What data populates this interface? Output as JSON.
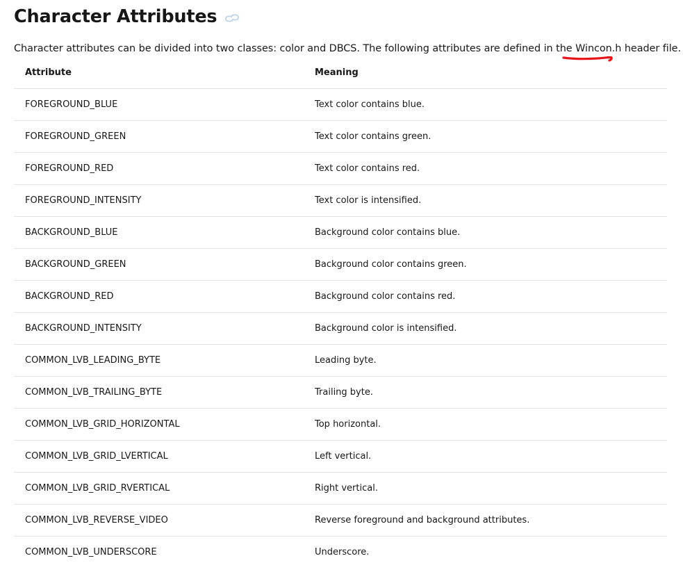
{
  "page": {
    "title": "Character Attributes",
    "intro_before": "Character attributes can be divided into two classes: color and DBCS. The following attributes are defined in the ",
    "intro_link": "Wincon.h",
    "intro_after": " header file."
  },
  "icons": {
    "permalink": "link-icon",
    "annotation": "red-underline-mark"
  },
  "colors": {
    "annotation_red": "#e8161b",
    "link_icon": "#b9d3ea",
    "row_border": "#e3e3e3"
  },
  "table": {
    "headers": [
      "Attribute",
      "Meaning"
    ],
    "rows": [
      [
        "FOREGROUND_BLUE",
        "Text color contains blue."
      ],
      [
        "FOREGROUND_GREEN",
        "Text color contains green."
      ],
      [
        "FOREGROUND_RED",
        "Text color contains red."
      ],
      [
        "FOREGROUND_INTENSITY",
        "Text color is intensified."
      ],
      [
        "BACKGROUND_BLUE",
        "Background color contains blue."
      ],
      [
        "BACKGROUND_GREEN",
        "Background color contains green."
      ],
      [
        "BACKGROUND_RED",
        "Background color contains red."
      ],
      [
        "BACKGROUND_INTENSITY",
        "Background color is intensified."
      ],
      [
        "COMMON_LVB_LEADING_BYTE",
        "Leading byte."
      ],
      [
        "COMMON_LVB_TRAILING_BYTE",
        "Trailing byte."
      ],
      [
        "COMMON_LVB_GRID_HORIZONTAL",
        "Top horizontal."
      ],
      [
        "COMMON_LVB_GRID_LVERTICAL",
        "Left vertical."
      ],
      [
        "COMMON_LVB_GRID_RVERTICAL",
        "Right vertical."
      ],
      [
        "COMMON_LVB_REVERSE_VIDEO",
        "Reverse foreground and background attributes."
      ],
      [
        "COMMON_LVB_UNDERSCORE",
        "Underscore."
      ]
    ]
  }
}
